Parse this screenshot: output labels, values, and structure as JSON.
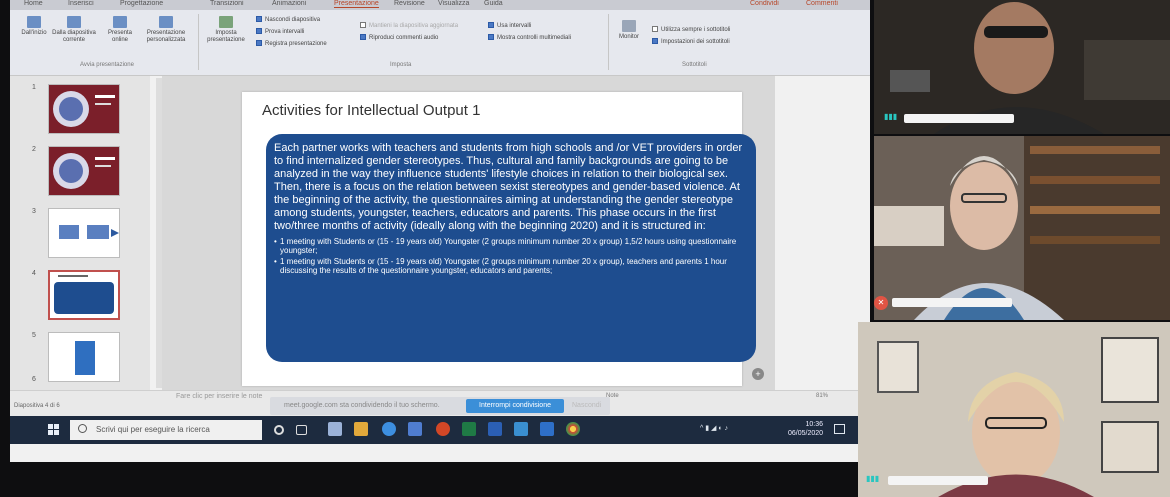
{
  "ribbon": {
    "tabs": [
      "Home",
      "Inserisci",
      "Progettazione",
      "Transizioni",
      "Animazioni",
      "Presentazione",
      "Revisione",
      "Visualizza",
      "Guida"
    ],
    "active_tab": "Presentazione",
    "share_label": "Condividi",
    "comments_label": "Commenti",
    "group1": {
      "buttons": [
        "Dall'inizio",
        "Dalla diapositiva corrente",
        "Presenta online",
        "Presentazione personalizzata"
      ],
      "label": "Avvia presentazione"
    },
    "group2": {
      "setup_label": "Imposta presentazione",
      "hide_slide": "Nascondi diapositiva",
      "rehearse": "Prova intervalli",
      "record": "Registra presentazione",
      "play_narrations": "Riproduci commenti audio",
      "use_timings": "Usa intervalli",
      "show_media_controls": "Mostra controlli multimediali",
      "keep_updated": "Mantieni la diapositiva aggiornata",
      "label": "Imposta"
    },
    "group3": {
      "monitor_label": "Monitor",
      "always_subtitles": "Utilizza sempre i sottotitoli",
      "subtitle_settings": "Impostazioni dei sottotitoli",
      "label": "Sottotitoli"
    }
  },
  "thumbnails": [
    {
      "number": "1"
    },
    {
      "number": "2"
    },
    {
      "number": "3"
    },
    {
      "number": "4",
      "selected": true
    },
    {
      "number": "5"
    },
    {
      "number": "6"
    }
  ],
  "slide": {
    "title": "Activities for Intellectual Output 1",
    "body": "Each partner works with teachers and students from high schools and /or VET providers in order to find internalized gender stereotypes. Thus, cultural and family backgrounds are going to be analyzed in the way they influence students' lifestyle choices in relation to their biological sex. Then, there is a focus on the relation between sexist stereotypes and gender-based violence. At the beginning of the activity, the questionnaires aiming at understanding the gender stereotype among students, youngster, teachers, educators and parents. This phase occurs in the first two/three months of activity (ideally along with the beginning 2020) and it is structured in:",
    "bullets": [
      "1 meeting with Students or (15 - 19 years old) Youngster (2 groups minimum number 20 x group) 1,5/2 hours using questionnaire youngster;",
      "1 meeting with Students or (15 - 19 years old) Youngster (2 groups minimum number 20 x group), teachers and parents 1 hour discussing the results of the questionnaire youngster, educators and parents;"
    ]
  },
  "notes": {
    "placeholder": "Fare clic per inserire le note",
    "slide_counter": "Diapositiva 4 di 6"
  },
  "share_bar": {
    "text": "meet.google.com sta condividendo il tuo schermo.",
    "stop_label": "Interrompi condivisione",
    "hide_label": "Nascondi"
  },
  "status_bar": {
    "notes_label": "Note",
    "zoom": "81%"
  },
  "taskbar": {
    "search_placeholder": "Scrivi qui per eseguire la ricerca",
    "time": "10:36",
    "date": "06/05/2020"
  },
  "colors": {
    "textbox_blue": "#1e4d8f",
    "accent_red": "#b7472a",
    "stop_share_blue": "#3b8fd8",
    "taskbar": "#1d2b3f",
    "audio_teal": "#29c6c0",
    "mic_muted": "#e05444"
  }
}
